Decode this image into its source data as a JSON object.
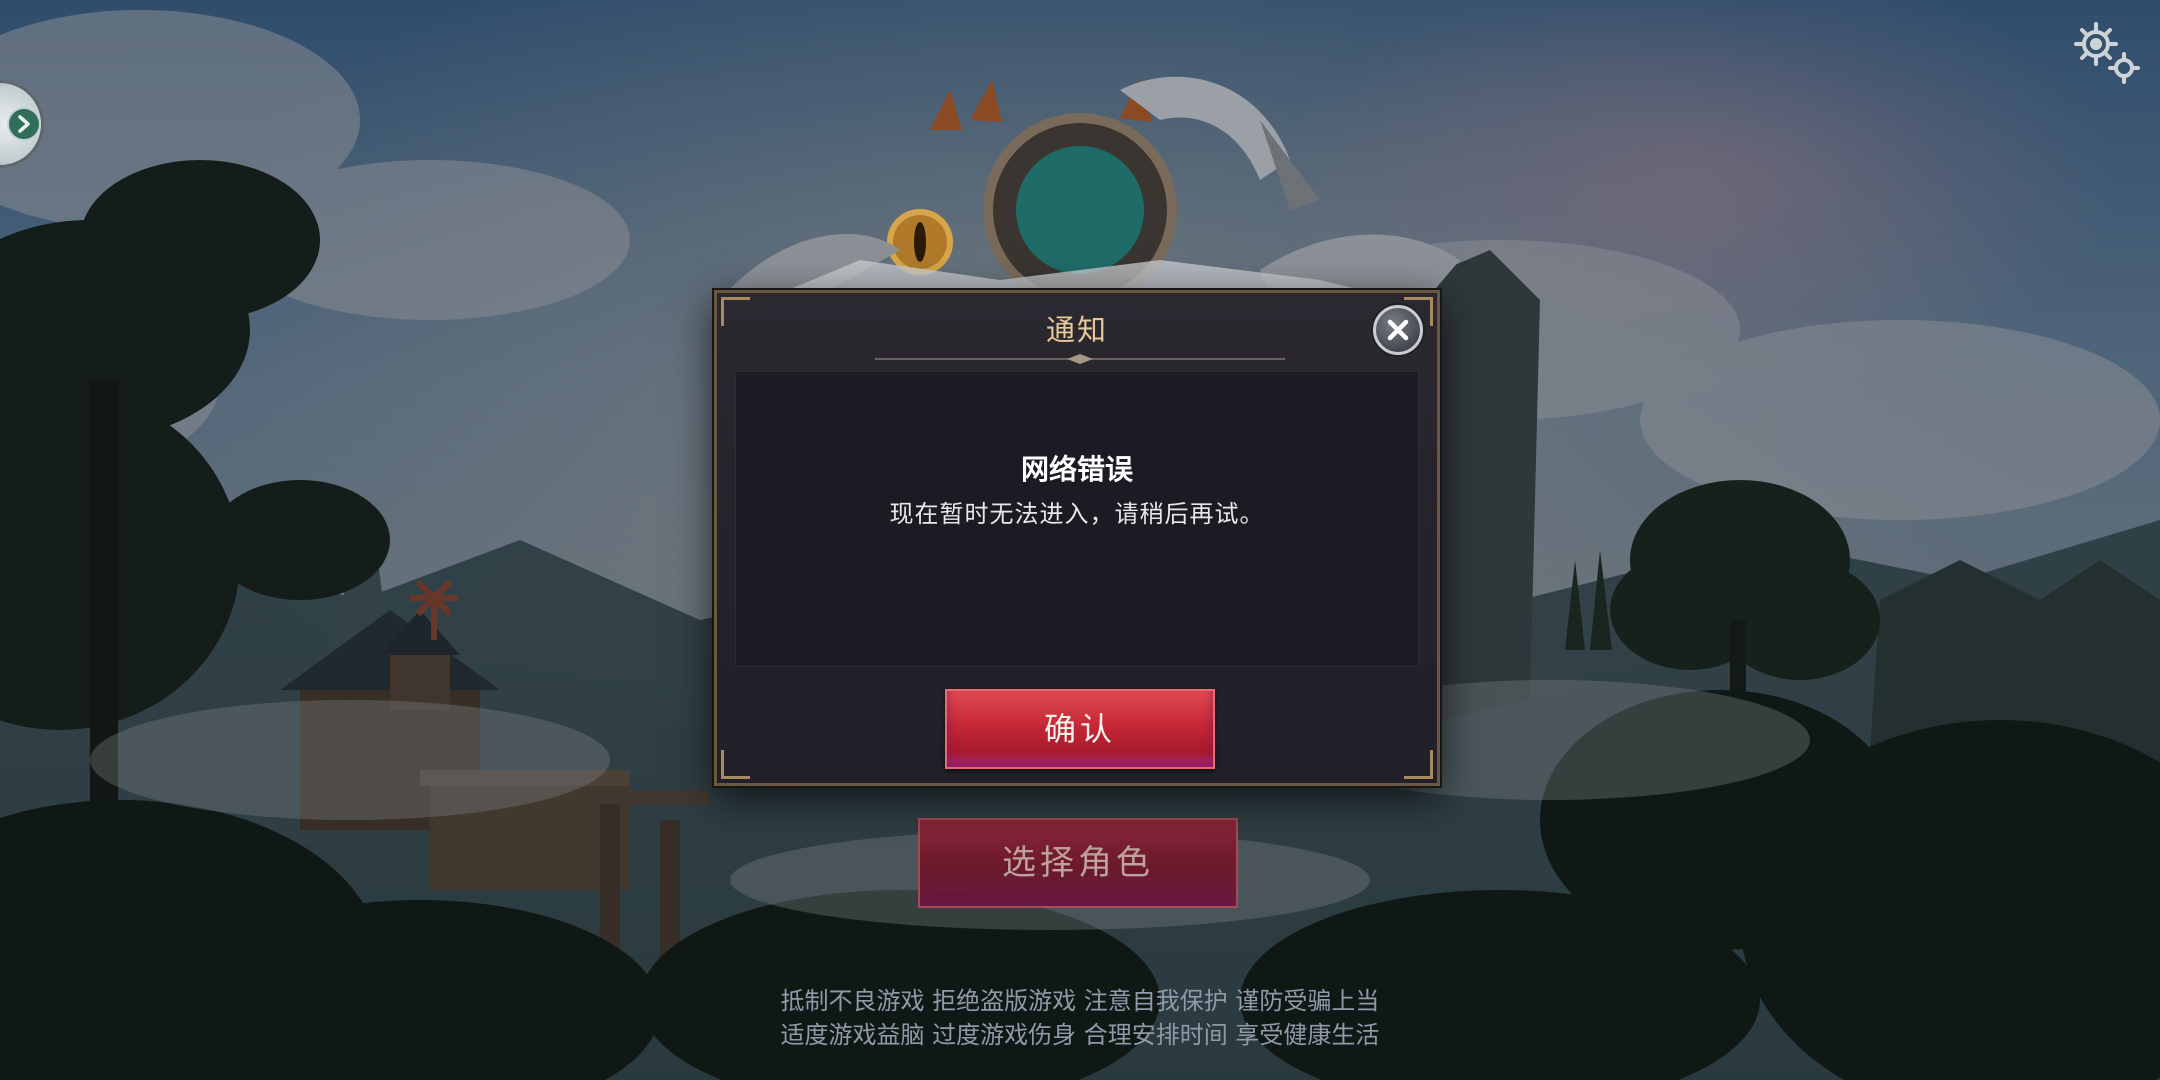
{
  "dialog": {
    "title": "通知",
    "message_title": "网络错误",
    "message_body": "现在暂时无法进入，请稍后再试。",
    "confirm_label": "确认",
    "close_icon": "close-icon"
  },
  "main": {
    "select_role_label": "选择角色"
  },
  "health_notice": {
    "line1": "抵制不良游戏 拒绝盗版游戏 注意自我保护 谨防受骗上当",
    "line2": "适度游戏益脑 过度游戏伤身 合理安排时间 享受健康生活"
  },
  "icons": {
    "settings": "gear-icon",
    "side_panel": "chevron-right-icon"
  },
  "colors": {
    "dialog_title": "#e7c89c",
    "confirm_button": "#c52736",
    "select_role_button": "#6e1527",
    "notice_text": "#8f9aa8"
  }
}
